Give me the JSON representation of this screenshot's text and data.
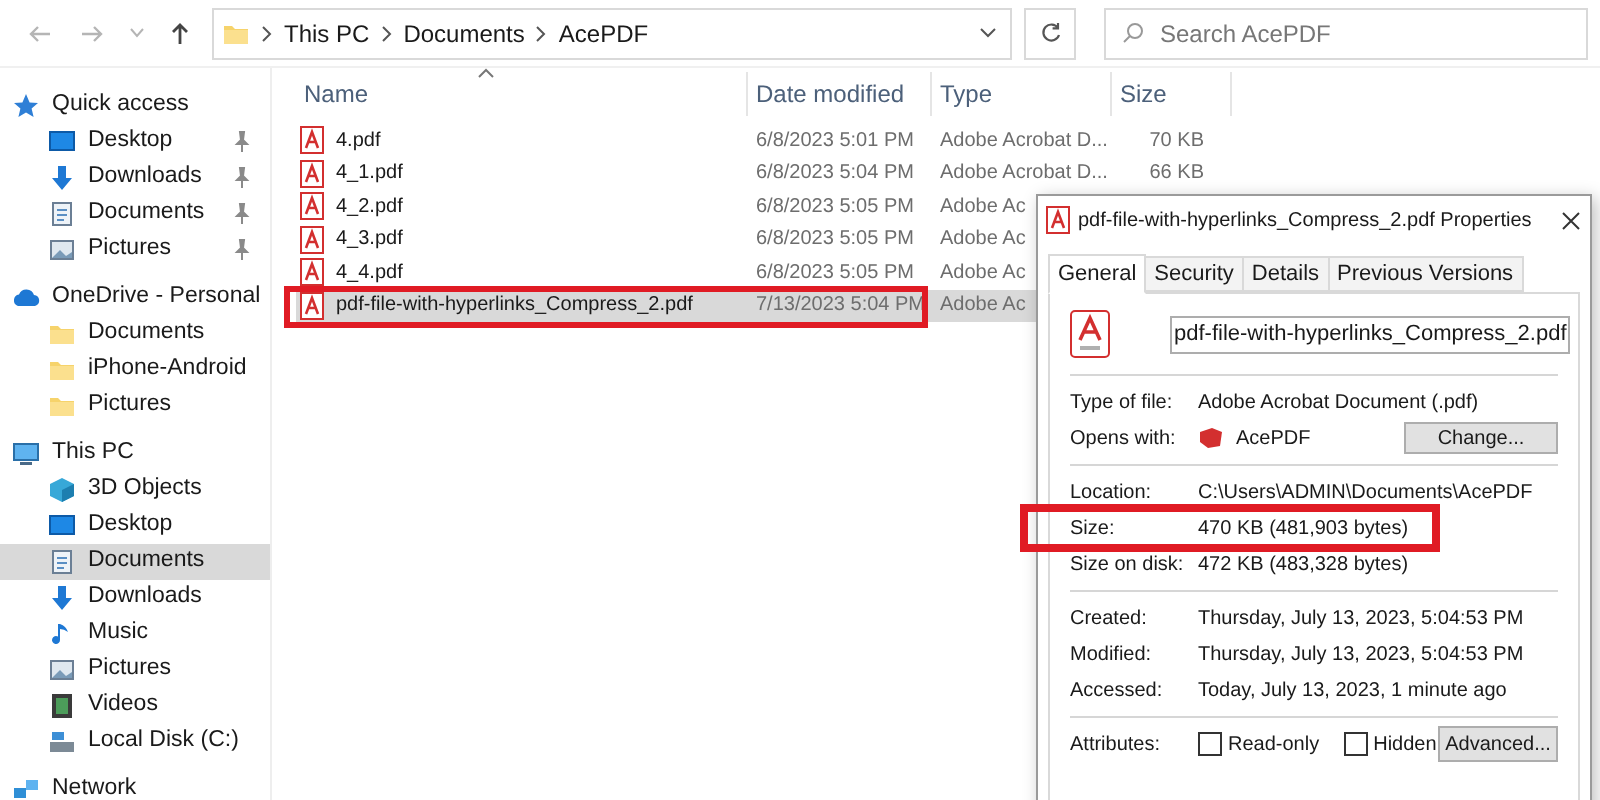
{
  "toolbar": {
    "breadcrumbs": [
      "This PC",
      "Documents",
      "AcePDF"
    ],
    "search": {
      "placeholder": "Search AcePDF"
    }
  },
  "sidebar": {
    "items": [
      {
        "label": "Quick access",
        "kind": "star",
        "selected": false,
        "children": [
          {
            "label": "Desktop",
            "kind": "desktop",
            "pinned": true,
            "selected": false
          },
          {
            "label": "Downloads",
            "kind": "download",
            "pinned": true,
            "selected": false
          },
          {
            "label": "Documents",
            "kind": "document",
            "pinned": true,
            "selected": false
          },
          {
            "label": "Pictures",
            "kind": "picture",
            "pinned": true,
            "selected": false
          }
        ]
      },
      {
        "label": "OneDrive - Personal",
        "kind": "cloud",
        "selected": false,
        "children": [
          {
            "label": "Documents",
            "kind": "folder",
            "selected": false
          },
          {
            "label": "iPhone-Android",
            "kind": "folder",
            "selected": false
          },
          {
            "label": "Pictures",
            "kind": "folder",
            "selected": false
          }
        ]
      },
      {
        "label": "This PC",
        "kind": "pc",
        "selected": false,
        "children": [
          {
            "label": "3D Objects",
            "kind": "cube",
            "selected": false
          },
          {
            "label": "Desktop",
            "kind": "desktop",
            "selected": false
          },
          {
            "label": "Documents",
            "kind": "document",
            "selected": true
          },
          {
            "label": "Downloads",
            "kind": "download",
            "selected": false
          },
          {
            "label": "Music",
            "kind": "music",
            "selected": false
          },
          {
            "label": "Pictures",
            "kind": "picture",
            "selected": false
          },
          {
            "label": "Videos",
            "kind": "video",
            "selected": false
          },
          {
            "label": "Local Disk (C:)",
            "kind": "disk",
            "selected": false
          }
        ]
      },
      {
        "label": "Network",
        "kind": "network",
        "selected": false
      }
    ]
  },
  "file_list": {
    "columns": [
      "Name",
      "Date modified",
      "Type",
      "Size"
    ],
    "rows": [
      {
        "name": "4.pdf",
        "date": "6/8/2023 5:01 PM",
        "type": "Adobe Acrobat D...",
        "size": "70 KB",
        "selected": false,
        "highlighted": false
      },
      {
        "name": "4_1.pdf",
        "date": "6/8/2023 5:04 PM",
        "type": "Adobe Acrobat D...",
        "size": "66 KB",
        "selected": false,
        "highlighted": false
      },
      {
        "name": "4_2.pdf",
        "date": "6/8/2023 5:05 PM",
        "type": "Adobe Ac",
        "selected": false,
        "highlighted": false
      },
      {
        "name": "4_3.pdf",
        "date": "6/8/2023 5:05 PM",
        "type": "Adobe Ac",
        "selected": false,
        "highlighted": false
      },
      {
        "name": "4_4.pdf",
        "date": "6/8/2023 5:05 PM",
        "type": "Adobe Ac",
        "selected": false,
        "highlighted": false
      },
      {
        "name": "pdf-file-with-hyperlinks_Compress_2.pdf",
        "date": "7/13/2023 5:04 PM",
        "type": "Adobe Ac",
        "selected": true,
        "highlighted": true
      }
    ]
  },
  "dialog": {
    "title": "pdf-file-with-hyperlinks_Compress_2.pdf Properties",
    "tabs": [
      {
        "label": "General",
        "selected": true
      },
      {
        "label": "Security",
        "selected": false
      },
      {
        "label": "Details",
        "selected": false
      },
      {
        "label": "Previous Versions",
        "selected": false
      }
    ],
    "file_name": "pdf-file-with-hyperlinks_Compress_2.pdf",
    "sections": [
      [
        {
          "kind": "text",
          "label": "Type of file:",
          "value": "Adobe Acrobat Document (.pdf)",
          "highlighted": false
        },
        {
          "kind": "app",
          "label": "Opens with:",
          "value": "AcePDF",
          "button": "Change...",
          "highlighted": false
        }
      ],
      [
        {
          "kind": "text",
          "label": "Location:",
          "value": "C:\\Users\\ADMIN\\Documents\\AcePDF",
          "highlighted": false
        },
        {
          "kind": "text",
          "label": "Size:",
          "value": "470 KB (481,903 bytes)",
          "highlighted": true
        },
        {
          "kind": "text",
          "label": "Size on disk:",
          "value": "472 KB (483,328 bytes)",
          "highlighted": false
        }
      ],
      [
        {
          "kind": "text",
          "label": "Created:",
          "value": "Thursday, July 13, 2023, 5:04:53 PM",
          "highlighted": false
        },
        {
          "kind": "text",
          "label": "Modified:",
          "value": "Thursday, July 13, 2023, 5:04:53 PM",
          "highlighted": false
        },
        {
          "kind": "text",
          "label": "Accessed:",
          "value": "Today, July 13, 2023, 1 minute ago",
          "highlighted": false
        }
      ],
      [
        {
          "kind": "attributes",
          "label": "Attributes:",
          "checkboxes": [
            {
              "label": "Read-only",
              "checked": false
            },
            {
              "label": "Hidden",
              "checked": false
            }
          ],
          "button": "Advanced...",
          "highlighted": false
        }
      ]
    ]
  }
}
